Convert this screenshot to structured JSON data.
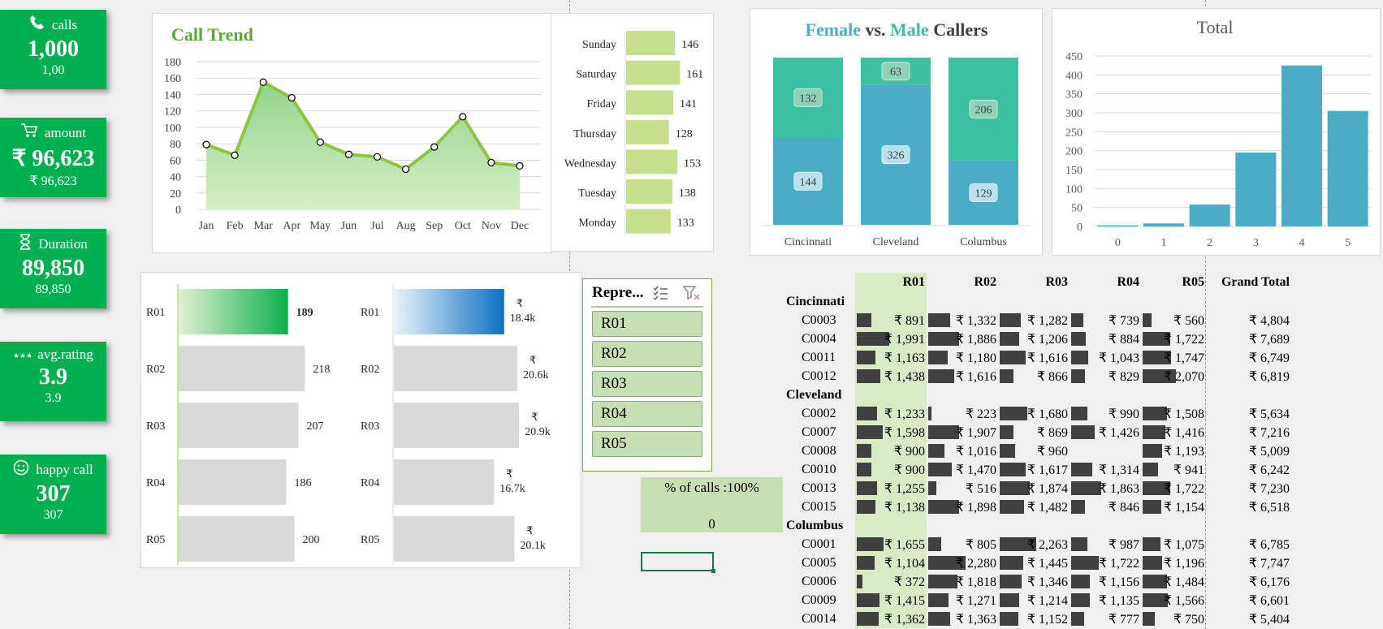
{
  "kpis": [
    {
      "icon": "phone-icon",
      "title": "calls",
      "value": "1,000",
      "sub": "1,00"
    },
    {
      "icon": "cart-icon",
      "title": "amount",
      "value": "₹ 96,623",
      "sub": "₹ 96,623"
    },
    {
      "icon": "hourglass-icon",
      "title": "Duration",
      "value": "89,850",
      "sub": "89,850"
    },
    {
      "icon": "stars-icon",
      "title": "avg.rating",
      "value": "3.9",
      "sub": "3.9"
    },
    {
      "icon": "smiley-icon",
      "title": "happy call",
      "value": "307",
      "sub": "307"
    }
  ],
  "call_trend": {
    "title": "Call Trend",
    "type": "area",
    "categories": [
      "Jan",
      "Feb",
      "Mar",
      "Apr",
      "May",
      "Jun",
      "Jul",
      "Aug",
      "Sep",
      "Oct",
      "Nov",
      "Dec"
    ],
    "values": [
      79,
      66,
      155,
      136,
      82,
      67,
      64,
      49,
      76,
      113,
      57,
      53
    ],
    "yticks": [
      "180",
      "160",
      "140",
      "120",
      "100",
      "80",
      "60",
      "40",
      "20",
      "0"
    ],
    "ylim": [
      0,
      180
    ]
  },
  "weekday": {
    "type": "bar",
    "categories": [
      "Sunday",
      "Saturday",
      "Friday",
      "Thursday",
      "Wednesday",
      "Tuesday",
      "Monday"
    ],
    "values": [
      146,
      161,
      141,
      128,
      153,
      138,
      133
    ],
    "labels": [
      "146",
      "161",
      "141",
      "128",
      "153",
      "138",
      "133"
    ]
  },
  "gender": {
    "title_female": "Female",
    "title_vs": "vs.",
    "title_male": "Male",
    "title_callers": "Callers",
    "type": "stacked-bar",
    "categories": [
      "Cincinnati",
      "Cleveland",
      "Columbus"
    ],
    "male": [
      132,
      63,
      206
    ],
    "female": [
      144,
      326,
      129
    ],
    "male_labels": [
      "132",
      "63",
      "206"
    ],
    "female_labels": [
      "144",
      "326",
      "129"
    ]
  },
  "total": {
    "title": "Total",
    "type": "bar",
    "categories": [
      "0",
      "1",
      "2",
      "3",
      "4",
      "5"
    ],
    "values": [
      3,
      8,
      58,
      195,
      425,
      305
    ],
    "yticks": [
      "450",
      "400",
      "350",
      "300",
      "250",
      "200",
      "150",
      "100",
      "50",
      "0"
    ],
    "ylim": [
      0,
      450
    ]
  },
  "rep_calls": {
    "type": "bar",
    "categories": [
      "R01",
      "R02",
      "R03",
      "R04",
      "R05"
    ],
    "values": [
      189,
      218,
      207,
      186,
      200
    ],
    "labels": [
      "189",
      "218",
      "207",
      "186",
      "200"
    ]
  },
  "rep_amount": {
    "type": "bar",
    "categories": [
      "R01",
      "R02",
      "R03",
      "R04",
      "R05"
    ],
    "values": [
      18.4,
      20.6,
      20.9,
      16.7,
      20.1
    ],
    "sym": "₹",
    "labels": [
      "18.4k",
      "20.6k",
      "20.9k",
      "16.7k",
      "20.1k"
    ]
  },
  "slicer": {
    "header": "Repre...",
    "items": [
      "R01",
      "R02",
      "R03",
      "R04",
      "R05"
    ]
  },
  "indicator": {
    "percent": "% of calls :100%",
    "zero": "0"
  },
  "pivot": {
    "headers": [
      "R01",
      "R02",
      "R03",
      "R04",
      "R05",
      "Grand Total"
    ],
    "groups": [
      {
        "city": "Cincinnati",
        "rows": [
          {
            "id": "C0003",
            "v": [
              "₹ 891",
              "₹ 1,332",
              "₹ 1,282",
              "₹ 739",
              "₹ 560",
              "₹ 4,804"
            ],
            "n": [
              891,
              1332,
              1282,
              739,
              560
            ]
          },
          {
            "id": "C0004",
            "v": [
              "₹ 1,991",
              "₹ 1,886",
              "₹ 1,206",
              "₹ 884",
              "₹ 1,722",
              "₹ 7,689"
            ],
            "n": [
              1991,
              1886,
              1206,
              884,
              1722
            ]
          },
          {
            "id": "C0011",
            "v": [
              "₹ 1,163",
              "₹ 1,180",
              "₹ 1,616",
              "₹ 1,043",
              "₹ 1,747",
              "₹ 6,749"
            ],
            "n": [
              1163,
              1180,
              1616,
              1043,
              1747
            ]
          },
          {
            "id": "C0012",
            "v": [
              "₹ 1,438",
              "₹ 1,616",
              "₹ 866",
              "₹ 829",
              "₹ 2,070",
              "₹ 6,819"
            ],
            "n": [
              1438,
              1616,
              866,
              829,
              2070
            ]
          }
        ]
      },
      {
        "city": "Cleveland",
        "rows": [
          {
            "id": "C0002",
            "v": [
              "₹ 1,233",
              "₹ 223",
              "₹ 1,680",
              "₹ 990",
              "₹ 1,508",
              "₹ 5,634"
            ],
            "n": [
              1233,
              223,
              1680,
              990,
              1508
            ]
          },
          {
            "id": "C0007",
            "v": [
              "₹ 1,598",
              "₹ 1,907",
              "₹ 869",
              "₹ 1,426",
              "₹ 1,416",
              "₹ 7,216"
            ],
            "n": [
              1598,
              1907,
              869,
              1426,
              1416
            ]
          },
          {
            "id": "C0008",
            "v": [
              "₹ 900",
              "₹ 1,016",
              "₹ 960",
              "₹ 1,193",
              "₹ 5,009",
              ""
            ],
            "n": [
              900,
              1016,
              960,
              0,
              1193
            ],
            "fix": true
          },
          {
            "id": "C0010",
            "v": [
              "₹ 900",
              "₹ 1,470",
              "₹ 1,617",
              "₹ 1,314",
              "₹ 941",
              "₹ 6,242"
            ],
            "n": [
              900,
              1470,
              1617,
              1314,
              941
            ]
          },
          {
            "id": "C0013",
            "v": [
              "₹ 1,255",
              "₹ 516",
              "₹ 1,874",
              "₹ 1,863",
              "₹ 1,722",
              "₹ 7,230"
            ],
            "n": [
              1255,
              516,
              1874,
              1863,
              1722
            ]
          },
          {
            "id": "C0015",
            "v": [
              "₹ 1,138",
              "₹ 1,898",
              "₹ 1,482",
              "₹ 846",
              "₹ 1,154",
              "₹ 6,518"
            ],
            "n": [
              1138,
              1898,
              1482,
              846,
              1154
            ]
          }
        ]
      },
      {
        "city": "Columbus",
        "rows": [
          {
            "id": "C0001",
            "v": [
              "₹ 1,655",
              "₹ 805",
              "₹ 2,263",
              "₹ 987",
              "₹ 1,075",
              "₹ 6,785"
            ],
            "n": [
              1655,
              805,
              2263,
              987,
              1075
            ]
          },
          {
            "id": "C0005",
            "v": [
              "₹ 1,104",
              "₹ 2,280",
              "₹ 1,445",
              "₹ 1,722",
              "₹ 1,196",
              "₹ 7,747"
            ],
            "n": [
              1104,
              2280,
              1445,
              1722,
              1196
            ]
          },
          {
            "id": "C0006",
            "v": [
              "₹ 372",
              "₹ 1,818",
              "₹ 1,346",
              "₹ 1,156",
              "₹ 1,484",
              "₹ 6,176"
            ],
            "n": [
              372,
              1818,
              1346,
              1156,
              1484
            ]
          },
          {
            "id": "C0009",
            "v": [
              "₹ 1,415",
              "₹ 1,271",
              "₹ 1,214",
              "₹ 1,135",
              "₹ 1,566",
              "₹ 6,601"
            ],
            "n": [
              1415,
              1271,
              1214,
              1135,
              1566
            ]
          },
          {
            "id": "C0014",
            "v": [
              "₹ 1,362",
              "₹ 1,363",
              "₹ 1,152",
              "₹ 777",
              "₹ 750",
              "₹ 5,404"
            ],
            "n": [
              1362,
              1363,
              1152,
              777,
              750
            ]
          }
        ]
      }
    ]
  }
}
